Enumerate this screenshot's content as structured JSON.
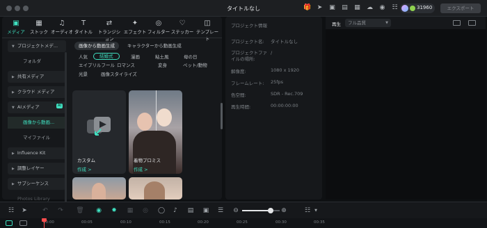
{
  "window": {
    "title": "タイトルなし"
  },
  "account": {
    "credits": "31960"
  },
  "export_label": "エクスポート",
  "tabs": [
    {
      "label": "メディア",
      "icon": "media-icon",
      "active": true
    },
    {
      "label": "ストック",
      "icon": "stock-icon"
    },
    {
      "label": "オーディオ",
      "icon": "music-icon"
    },
    {
      "label": "タイトル",
      "icon": "title-icon"
    },
    {
      "label": "トランジション",
      "icon": "transition-icon"
    },
    {
      "label": "エフェクト",
      "icon": "effect-icon"
    },
    {
      "label": "フィルター",
      "icon": "filter-icon"
    },
    {
      "label": "ステッカー",
      "icon": "sticker-icon"
    },
    {
      "label": "テンプレート",
      "icon": "template-icon"
    }
  ],
  "sidebar": {
    "project_media": "プロジェクトメデ...",
    "folder": "フォルダ",
    "shared_media": "共有メディア",
    "cloud_media": "クラウド メディア",
    "ai_media": "AIメディア",
    "ai_badge": "AI",
    "image_to_video": "画像から動画...",
    "my_files": "マイファイル",
    "influence_kit": "Influence Kit",
    "adjustment_layer": "調整レイヤー",
    "subsequence": "サブシーケンス",
    "photos_library": "Photos Library"
  },
  "content": {
    "mode_tabs": [
      "画像から動画生成",
      "キャラクターから動画生成"
    ],
    "style_chips": [
      [
        "人気",
        "結婚式",
        "漫画",
        "粘土風",
        "母の日"
      ],
      [
        "エイプリルフール",
        "ロマンス",
        "変身",
        "ペット/動物"
      ],
      [
        "光景",
        "画像スタイライズ"
      ]
    ],
    "cards": [
      {
        "label": "カスタム",
        "action": "作成 >"
      },
      {
        "label": "着物プロミス",
        "action": "作成 >"
      }
    ]
  },
  "project_info": {
    "header": "プロジェクト情報",
    "rows": [
      {
        "label": "プロジェクト名:",
        "value": "タイトルなし"
      },
      {
        "label": "プロジェクトファイルの場所:",
        "value": "/"
      },
      {
        "label": "解像度:",
        "value": "1080 x 1920"
      },
      {
        "label": "フレームレート:",
        "value": "25fps"
      },
      {
        "label": "色空間:",
        "value": "SDR - Rec.709"
      },
      {
        "label": "再生時間:",
        "value": "00:00:00:00"
      }
    ]
  },
  "preview": {
    "play_label": "再生",
    "quality": "フル品質"
  },
  "timeline": {
    "ruler_ticks": [
      "00:00",
      "00:05",
      "00:10",
      "00:15",
      "00:20",
      "00:25",
      "00:30",
      "00:35"
    ],
    "zoom_level": 0.75
  },
  "colors": {
    "accent": "#3fe0c0",
    "playhead": "#ff4d4d"
  }
}
